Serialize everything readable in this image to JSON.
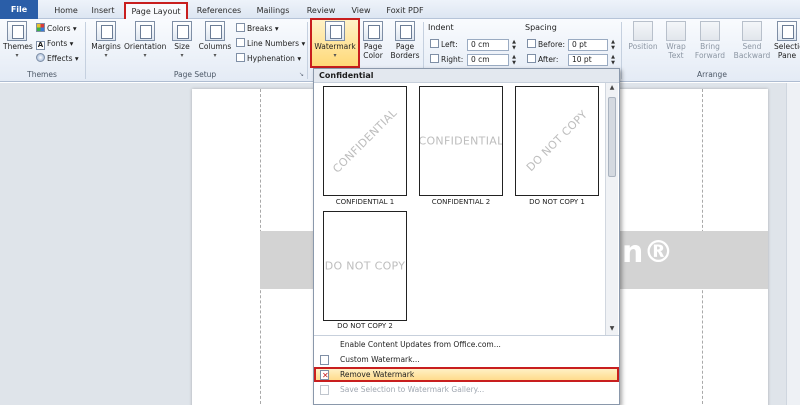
{
  "tabs": [
    {
      "label": "File"
    },
    {
      "label": "Home"
    },
    {
      "label": "Insert"
    },
    {
      "label": "Page Layout"
    },
    {
      "label": "References"
    },
    {
      "label": "Mailings"
    },
    {
      "label": "Review"
    },
    {
      "label": "View"
    },
    {
      "label": "Foxit PDF"
    }
  ],
  "ribbon": {
    "themes": {
      "button": "Themes",
      "colors": "Colors",
      "fonts": "Fonts",
      "effects": "Effects",
      "group_label": "Themes"
    },
    "page_setup": {
      "margins": "Margins",
      "orientation": "Orientation",
      "size": "Size",
      "columns": "Columns",
      "breaks": "Breaks",
      "line_numbers": "Line Numbers",
      "hyphenation": "Hyphenation",
      "group_label": "Page Setup"
    },
    "page_background": {
      "watermark": "Watermark",
      "page_color": "Page Color",
      "page_borders": "Page Borders"
    },
    "paragraph": {
      "indent_heading": "Indent",
      "left_label": "Left:",
      "left_value": "0 cm",
      "right_label": "Right:",
      "right_value": "0 cm",
      "spacing_heading": "Spacing",
      "before_label": "Before:",
      "before_value": "0 pt",
      "after_label": "After:",
      "after_value": "10 pt"
    },
    "arrange": {
      "position": "Position",
      "wrap_text": "Wrap Text",
      "bring_forward": "Bring Forward",
      "send_backward": "Send Backward",
      "selection_pane": "Selection Pane",
      "group_label": "Arrange"
    }
  },
  "watermark_gallery": {
    "section_header": "Confidential",
    "items": [
      {
        "preview": "CONFIDENTIAL",
        "label": "CONFIDENTIAL 1",
        "orientation": "diagonal"
      },
      {
        "preview": "CONFIDENTIAL",
        "label": "CONFIDENTIAL 2",
        "orientation": "horizontal"
      },
      {
        "preview": "DO NOT COPY",
        "label": "DO NOT COPY 1",
        "orientation": "diagonal"
      },
      {
        "preview": "DO NOT COPY",
        "label": "DO NOT COPY 2",
        "orientation": "horizontal"
      }
    ],
    "menu": {
      "enable_updates": "Enable Content Updates from Office.com...",
      "custom": "Custom Watermark...",
      "remove": "Remove Watermark",
      "save_selection": "Save Selection to Watermark Gallery..."
    }
  },
  "document": {
    "band_logo": "n®"
  },
  "colors": {
    "accent_highlight": "#c81e1e",
    "file_tab": "#2a5ea8",
    "hover_fill": "#ffd882"
  }
}
